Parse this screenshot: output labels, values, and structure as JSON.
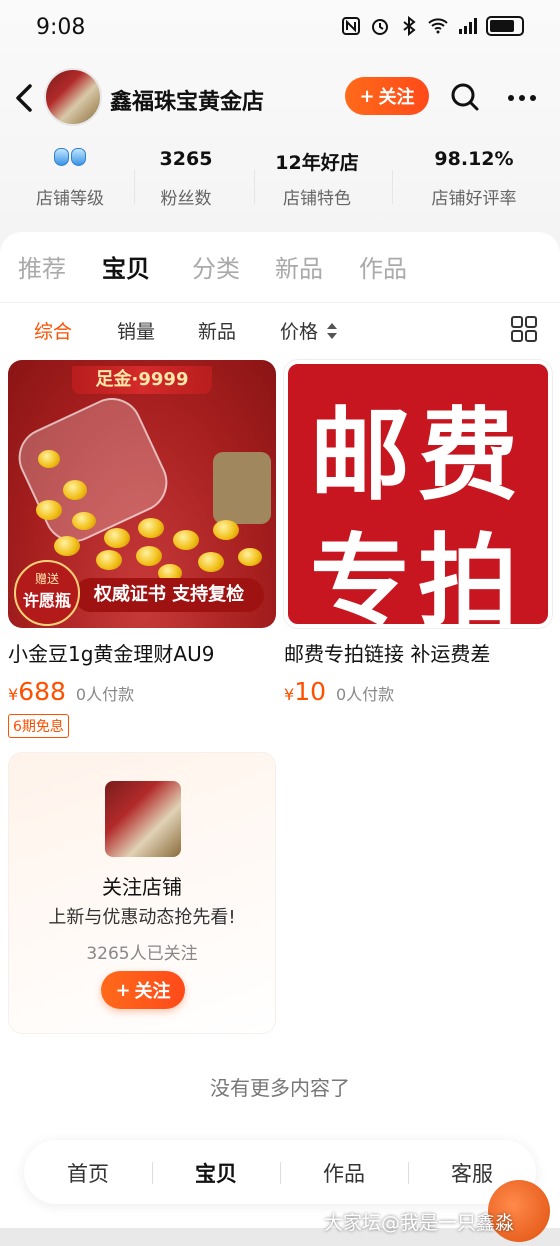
{
  "status_bar": {
    "time": "9:08"
  },
  "header": {
    "shop_name": "鑫福珠宝黄金店",
    "follow_label": "关注"
  },
  "stats": [
    {
      "value": "",
      "label": "店铺等级"
    },
    {
      "value": "3265",
      "label": "粉丝数"
    },
    {
      "value": "12年好店",
      "label": "店铺特色"
    },
    {
      "value": "98.12%",
      "label": "店铺好评率"
    }
  ],
  "tabs": [
    "推荐",
    "宝贝",
    "分类",
    "新品",
    "作品"
  ],
  "active_tab": "宝贝",
  "filters": [
    "综合",
    "销量",
    "新品",
    "价格"
  ],
  "products": [
    {
      "title": "小金豆1g黄金理财AU9",
      "currency": "¥",
      "price": "688",
      "paid": "0人付款",
      "badge": "6期免息",
      "image_text": {
        "banner": "足金·9999",
        "gift_top": "赠送",
        "gift_bottom": "许愿瓶",
        "bottom": "权威证书 支持复检"
      }
    },
    {
      "title": "邮费专拍链接 补运费差",
      "currency": "¥",
      "price": "10",
      "paid": "0人付款",
      "image_text": {
        "line1": "邮费",
        "line2": "专拍"
      }
    }
  ],
  "follow_card": {
    "title": "关注店铺",
    "subtitle": "上新与优惠动态抢先看!",
    "count": "3265人已关注",
    "button": "关注"
  },
  "no_more": "没有更多内容了",
  "bottom_nav": [
    "首页",
    "宝贝",
    "作品",
    "客服"
  ],
  "watermark": "大家坛@我是一只鑫淼",
  "colors": {
    "accent": "#ff5000",
    "button": "#ff5a1a",
    "image_red": "#c7161f"
  }
}
